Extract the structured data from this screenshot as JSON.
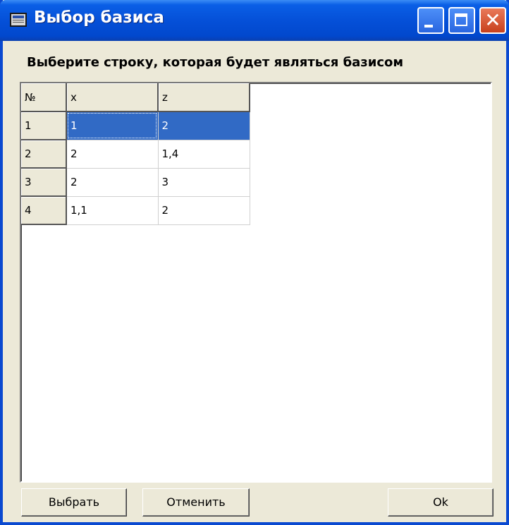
{
  "window": {
    "title": "Выбор базиса",
    "icon": "window-app-icon",
    "controls": {
      "minimize": "minimize-icon",
      "maximize": "maximize-icon",
      "close": "✕"
    }
  },
  "prompt": "Выберите строку, которая будет являться базисом",
  "grid": {
    "headers": [
      "№",
      "x",
      "z"
    ],
    "rows": [
      {
        "num": "1",
        "x": "1",
        "z": "2",
        "selected": true
      },
      {
        "num": "2",
        "x": "2",
        "z": "1,4",
        "selected": false
      },
      {
        "num": "3",
        "x": "2",
        "z": "3",
        "selected": false
      },
      {
        "num": "4",
        "x": "1,1",
        "z": "2",
        "selected": false
      }
    ],
    "selection_color": "#316ac5"
  },
  "buttons": {
    "select": "Выбрать",
    "cancel": "Отменить",
    "ok": "Ok"
  },
  "colors": {
    "titlebar": "#0550d8",
    "dialog_bg": "#ece9d8",
    "close_button": "#c8401c"
  }
}
